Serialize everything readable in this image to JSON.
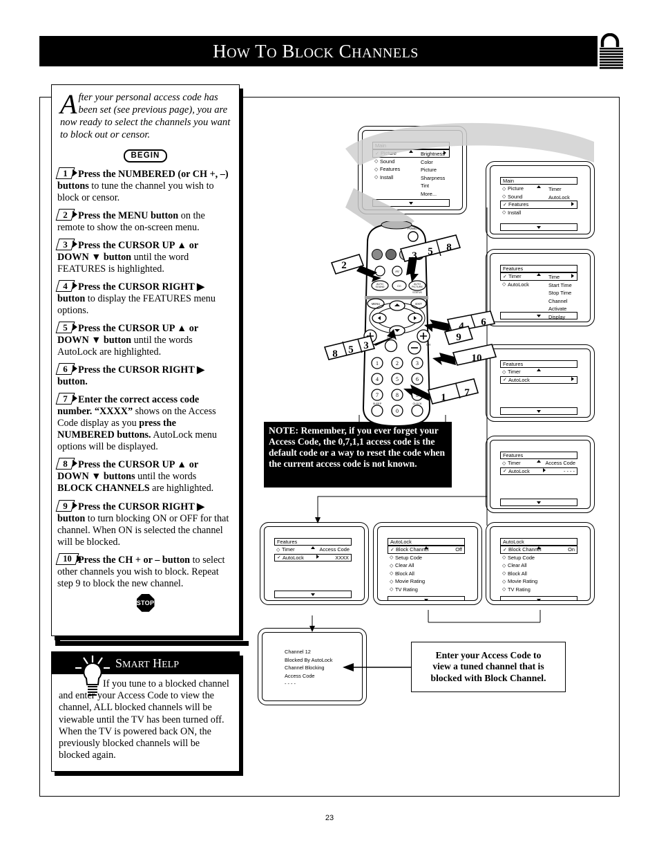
{
  "header": {
    "title_words": [
      "How",
      "to",
      "Block",
      "Channels"
    ],
    "lock_icon": "padlock-icon"
  },
  "intro": {
    "dropcap": "A",
    "text": "fter your personal access code has been set (see previous page), you are now ready to select the channels you want to block out or censor.",
    "begin_label": "BEGIN",
    "stop_label": "STOP"
  },
  "steps": [
    {
      "num": "1",
      "html": "<b>Press the NUMBERED (or CH +, &ndash;) buttons</b> to tune the channel you wish to block or censor."
    },
    {
      "num": "2",
      "html": "<b>Press the MENU button</b> on the remote to show the on-screen menu."
    },
    {
      "num": "3",
      "html": "<b>Press the CURSOR UP &#9650; or DOWN &#9660; button</b> until the word FEATURES is highlighted."
    },
    {
      "num": "4",
      "html": "<b>Press the CURSOR RIGHT &#9654; button</b> to display the FEATURES menu options."
    },
    {
      "num": "5",
      "html": "<b>Press the CURSOR UP &#9650; or DOWN &#9660; button</b> until the words AutoLock are highlighted."
    },
    {
      "num": "6",
      "html": "<b>Press the CURSOR RIGHT &#9654; button.</b>"
    },
    {
      "num": "7",
      "html": "<b>Enter the correct access code number. &ldquo;XXXX&rdquo;</b> shows on the Access Code display as you <b>press the NUMBERED buttons.</b> AutoLock menu options will be displayed."
    },
    {
      "num": "8",
      "html": "<b>Press the CURSOR UP &#9650; or DOWN &#9660; buttons</b> until the words <b>BLOCK CHANNELS</b> are highlighted."
    },
    {
      "num": "9",
      "html": "<b>Press the CURSOR RIGHT &#9654; button</b> to turn blocking ON or OFF for that channel. When ON is selected the channel will be blocked."
    },
    {
      "num": "10",
      "html": "<b>Press the CH + or &ndash; button</b> to select other channels you wish to block. Repeat step 9 to block the new channel."
    }
  ],
  "smart_help": {
    "title_words": [
      "Smart",
      "Help"
    ],
    "icon": "lightbulb-icon",
    "text": "If you tune to a blocked channel and enter your Access Code to view the channel, ALL blocked channels will be viewable until the TV has been turned off. When the TV is powered back ON, the previously blocked channels will be blocked again."
  },
  "note": {
    "text": "NOTE: Remember, if you ever forget your Access Code, the 0,7,1,1 access code is the default code or a way to reset the code when the current access code is not known."
  },
  "callout": {
    "lines": [
      "Enter your Access Code to",
      "view a tuned channel that is",
      "blocked with Block Channel."
    ]
  },
  "screens": [
    {
      "id": "main-picture",
      "head": "Main",
      "rows": [
        {
          "mark": "check",
          "label": "Picture",
          "arrow": true,
          "boxed": true
        },
        {
          "mark": "diamond",
          "label": "Sound"
        },
        {
          "mark": "diamond",
          "label": "Features"
        },
        {
          "mark": "diamond",
          "label": "Install"
        }
      ],
      "column": [
        "Brightness",
        "Color",
        "Picture",
        "Sharpness",
        "Tint",
        "More..."
      ]
    },
    {
      "id": "main-features",
      "head": "Main",
      "rows": [
        {
          "mark": "diamond",
          "label": "Picture"
        },
        {
          "mark": "diamond",
          "label": "Sound"
        },
        {
          "mark": "check",
          "label": "Features",
          "arrow": true,
          "boxed": true
        },
        {
          "mark": "diamond",
          "label": "Install"
        }
      ],
      "column": [
        "Timer",
        "AutoLock"
      ]
    },
    {
      "id": "features-timer",
      "head": "Features",
      "rows": [
        {
          "mark": "check",
          "label": "Timer",
          "arrow": true,
          "boxed": true
        },
        {
          "mark": "diamond",
          "label": "AutoLock"
        }
      ],
      "column": [
        "Time",
        "Start Time",
        "Stop Time",
        "Channel",
        "Activate",
        "Display"
      ]
    },
    {
      "id": "features-autolock",
      "head": "Features",
      "rows": [
        {
          "mark": "diamond",
          "label": "Timer"
        },
        {
          "mark": "check",
          "label": "AutoLock",
          "arrow": true,
          "boxed": true
        }
      ],
      "column": []
    },
    {
      "id": "features-autolock-accesscode",
      "head": "Features",
      "rows": [
        {
          "mark": "diamond",
          "label": "Timer",
          "value": "Access Code"
        },
        {
          "mark": "check",
          "label": "AutoLock",
          "arrow": true,
          "boxed": true,
          "value": "- - - -"
        }
      ],
      "column": []
    },
    {
      "id": "features-autolock-xxxx",
      "head": "Features",
      "rows": [
        {
          "mark": "diamond",
          "label": "Timer",
          "value": "Access Code"
        },
        {
          "mark": "check",
          "label": "AutoLock",
          "arrow": true,
          "boxed": true,
          "value": "XXXX"
        }
      ],
      "column": []
    },
    {
      "id": "autolock-block-off",
      "head": "AutoLock",
      "rows": [
        {
          "mark": "check",
          "label": "Block Channel",
          "value": "Off",
          "boxed": true
        },
        {
          "mark": "diamond",
          "label": "Setup Code"
        },
        {
          "mark": "diamond",
          "label": "Clear All"
        },
        {
          "mark": "diamond",
          "label": "Block All"
        },
        {
          "mark": "diamond",
          "label": "Movie Rating"
        },
        {
          "mark": "diamond",
          "label": "TV Rating"
        }
      ],
      "column": []
    },
    {
      "id": "autolock-block-on",
      "head": "AutoLock",
      "rows": [
        {
          "mark": "check",
          "label": "Block Channel",
          "value": "On",
          "boxed": true
        },
        {
          "mark": "diamond",
          "label": "Setup Code"
        },
        {
          "mark": "diamond",
          "label": "Clear All"
        },
        {
          "mark": "diamond",
          "label": "Block All"
        },
        {
          "mark": "diamond",
          "label": "Movie Rating"
        },
        {
          "mark": "diamond",
          "label": "TV Rating"
        }
      ],
      "column": []
    }
  ],
  "blocked_screen": {
    "lines": [
      "Channel 12",
      "Blocked By AutoLock",
      "Channel Blocking",
      "Access Code",
      "- - - -"
    ]
  },
  "remote": {
    "power_label": "POWER",
    "labels": [
      "MENU",
      "EXIT",
      "CC",
      "AV",
      "AUTO SOUND",
      "AUTO PICTURE",
      "STATUS",
      "VOL",
      "MUTE",
      "CH",
      "SLEEP",
      "CLOCK"
    ],
    "keypad": [
      "1",
      "2",
      "3",
      "4",
      "5",
      "6",
      "7",
      "8",
      "9",
      "0"
    ],
    "callout_flags": [
      "2",
      "3",
      "5",
      "8",
      "4",
      "6",
      "8",
      "5",
      "3",
      "9",
      "10",
      "1",
      "7"
    ]
  },
  "page_number": "23"
}
